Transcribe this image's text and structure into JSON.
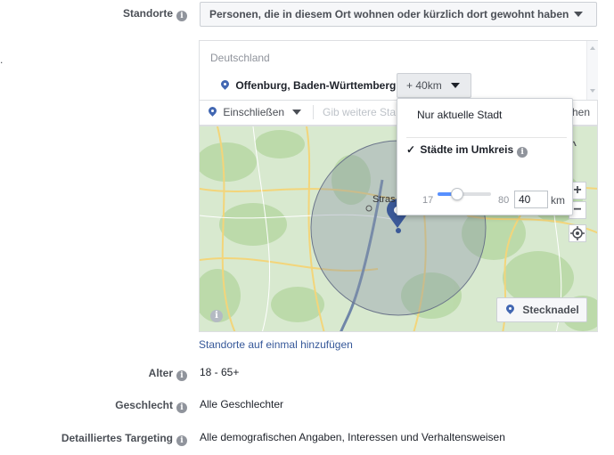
{
  "locations": {
    "label": "Standorte",
    "mode_dropdown": "Personen, die in diesem Ort wohnen oder kürzlich dort gewohnt haben",
    "country": "Deutschland",
    "selected_location": "Offenburg, Baden-Württemberg",
    "radius_button": "+ 40km",
    "include_dropdown": "Einschließen",
    "search_placeholder": "Gib weitere Sta",
    "search_suffix": "hen",
    "bulk_link": "Standorte auf einmal hinzufügen",
    "pin_button": "Stecknadel",
    "map_city_label": "Stras",
    "stray_mark": "."
  },
  "radius_popup": {
    "option_city_only": "Nur aktuelle Stadt",
    "check_mark": "✓",
    "option_radius": "Städte im Umkreis",
    "slider_min": "17",
    "slider_max": "80",
    "radius_value": "40",
    "unit": "km",
    "slider_fraction": 0.37
  },
  "age": {
    "label": "Alter",
    "value": "18 - 65+"
  },
  "gender": {
    "label": "Geschlecht",
    "value": "Alle Geschlechter"
  },
  "detailed": {
    "label": "Detailliertes Targeting",
    "value": "Alle demografischen Angaben, Interessen und Verhaltensweisen"
  },
  "icons": {
    "info": "i",
    "zoom_in": "+",
    "zoom_out": "−",
    "locate": "locate-icon",
    "chevron_up": "^"
  },
  "colors": {
    "accent": "#4267b2",
    "link": "#365899",
    "map_green": "#cfe5c3",
    "radius_circle": "#8a94a8"
  }
}
